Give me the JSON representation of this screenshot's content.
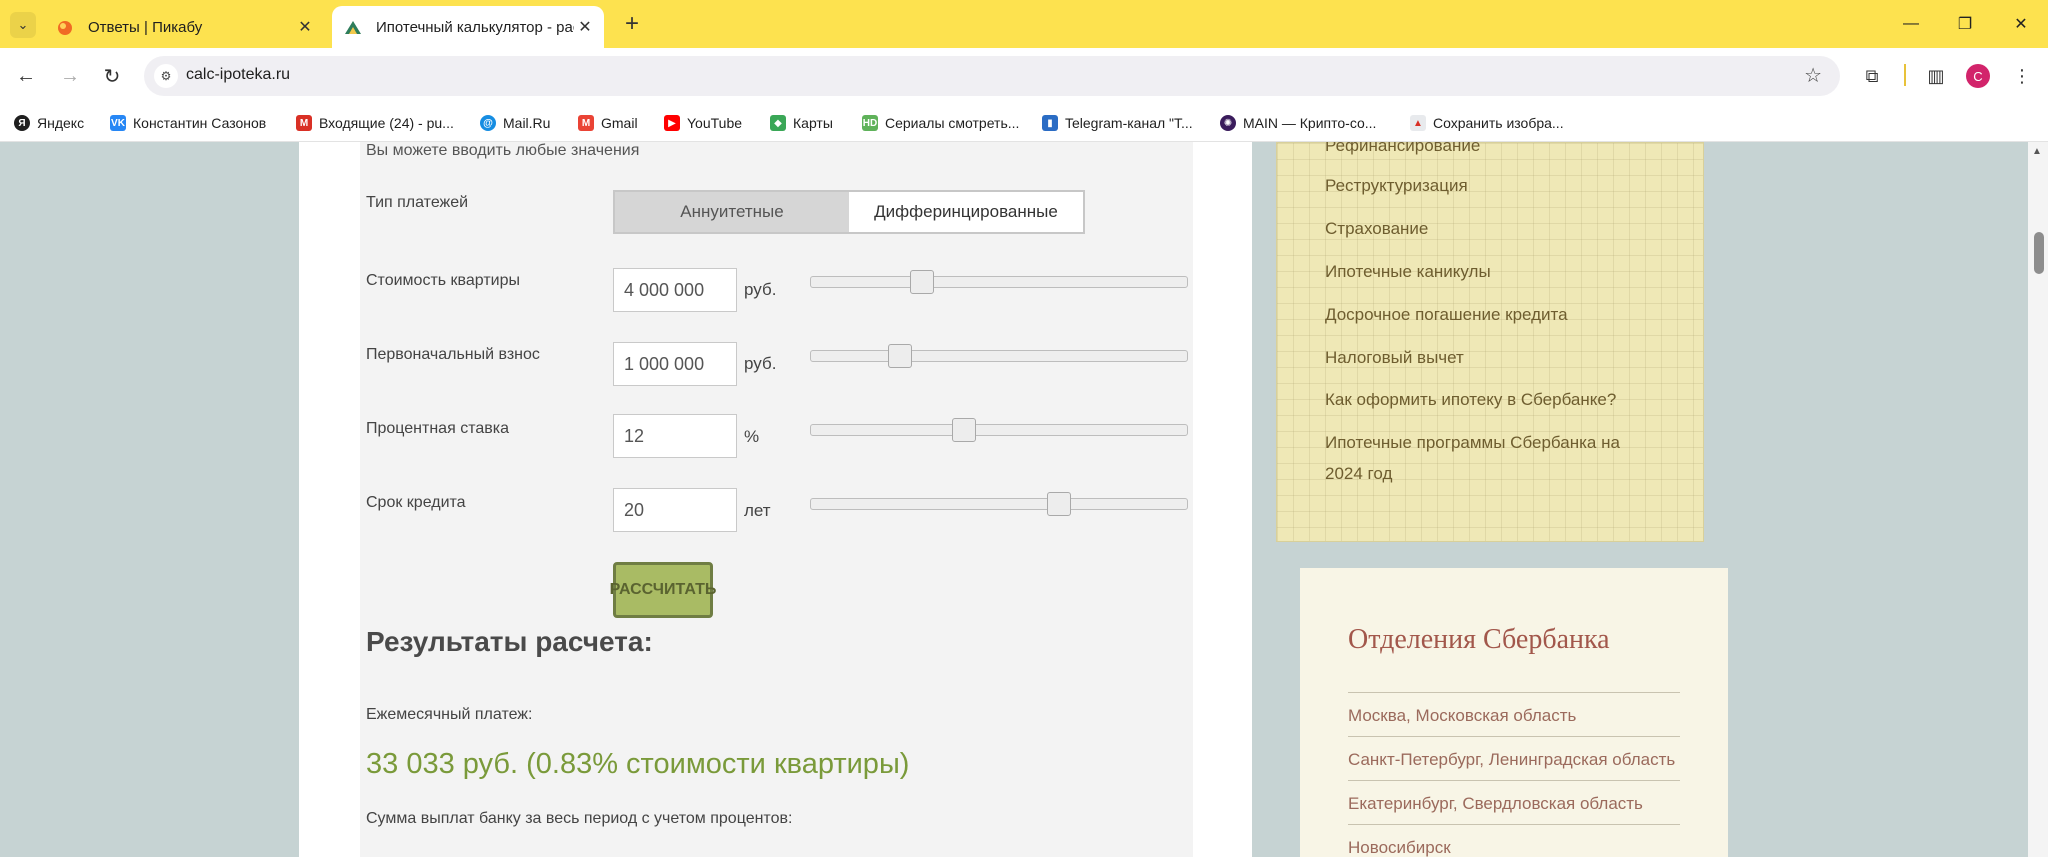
{
  "browser": {
    "tabs": [
      {
        "title": "Ответы | Пикабу",
        "active": false
      },
      {
        "title": "Ипотечный калькулятор - рас",
        "active": true
      }
    ],
    "url": "calc-ipoteka.ru",
    "profile_letter": "С",
    "bookmarks": [
      "Яндекс",
      "Константин Сазонов",
      "Входящие (24) - pu...",
      "Mail.Ru",
      "Gmail",
      "YouTube",
      "Карты",
      "Сериалы смотреть...",
      "Telegram-канал \"Т...",
      "MAIN — Крипто-со...",
      "Сохранить изобра..."
    ]
  },
  "calculator": {
    "hint": "Вы можете вводить любые значения",
    "payment_type_label": "Тип платежей",
    "payment_types": [
      "Аннуитетные",
      "Дифферинцированные"
    ],
    "fields": [
      {
        "label": "Стоимость квартиры",
        "value": "4 000 000",
        "unit": "руб.",
        "slider_fraction": 0.28
      },
      {
        "label": "Первоначальный взнос",
        "value": "1 000 000",
        "unit": "руб.",
        "slider_fraction": 0.22
      },
      {
        "label": "Процентная ставка",
        "value": "12",
        "unit": "%",
        "slider_fraction": 0.4
      },
      {
        "label": "Срок кредита",
        "value": "20",
        "unit": "лет",
        "slider_fraction": 0.67
      }
    ],
    "button_label": "РАССЧИТАТЬ"
  },
  "results": {
    "title": "Результаты расчета:",
    "monthly_label": "Ежемесячный платеж:",
    "monthly_value": "33 033 руб. (0.83% стоимости квартиры)",
    "total_label": "Сумма выплат банку за весь период с учетом процентов:"
  },
  "sidebar_menu": {
    "items": [
      "Рефинансирование",
      "Реструктуризация",
      "Страхование",
      "Ипотечные каникулы",
      "Досрочное погашение кредита",
      "Налоговый вычет",
      "Как оформить ипотеку в Сбербанке?",
      "Ипотечные программы Сбербанка на",
      "2024 год"
    ]
  },
  "branches": {
    "title": "Отделения  Сбербанка",
    "items": [
      "Москва, Московская область",
      "Санкт-Петербург, Ленинградская область",
      "Екатеринбург, Свердловская область",
      "Новосибирск"
    ]
  },
  "colors": {
    "tabstrip": "#fde24f",
    "accent_green": "#7a9a3a",
    "button": "#a9bb64",
    "branch_title": "#a2574b"
  }
}
